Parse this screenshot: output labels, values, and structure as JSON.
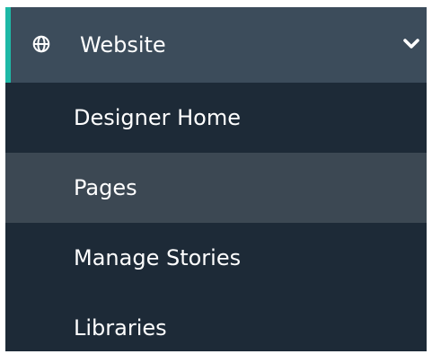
{
  "sidebar": {
    "section": {
      "label": "Website",
      "icon": "globe-icon",
      "toggle_icon": "chevron-down-icon",
      "expanded": true,
      "accent_color": "#1eb8a6"
    },
    "items": [
      {
        "label": "Designer Home",
        "active": false
      },
      {
        "label": "Pages",
        "active": true
      },
      {
        "label": "Manage Stories",
        "active": false
      },
      {
        "label": "Libraries",
        "active": false
      }
    ]
  },
  "colors": {
    "background": "#1d2a37",
    "header_background": "#3c4c5b",
    "active_item_background": "#3c4853",
    "text": "#ffffff"
  }
}
